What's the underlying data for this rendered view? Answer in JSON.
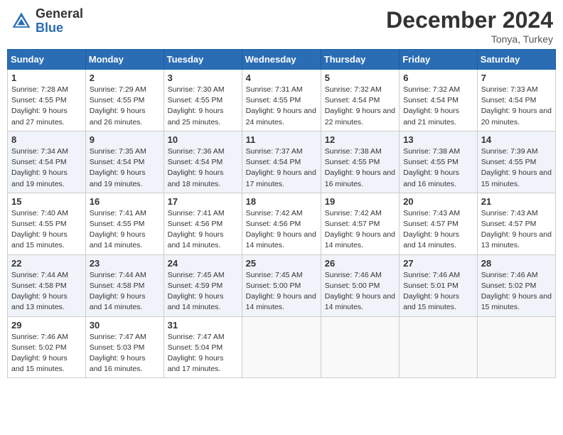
{
  "header": {
    "logo_general": "General",
    "logo_blue": "Blue",
    "title": "December 2024",
    "location": "Tonya, Turkey"
  },
  "days_of_week": [
    "Sunday",
    "Monday",
    "Tuesday",
    "Wednesday",
    "Thursday",
    "Friday",
    "Saturday"
  ],
  "weeks": [
    [
      {
        "day": "1",
        "sunrise": "Sunrise: 7:28 AM",
        "sunset": "Sunset: 4:55 PM",
        "daylight": "Daylight: 9 hours and 27 minutes."
      },
      {
        "day": "2",
        "sunrise": "Sunrise: 7:29 AM",
        "sunset": "Sunset: 4:55 PM",
        "daylight": "Daylight: 9 hours and 26 minutes."
      },
      {
        "day": "3",
        "sunrise": "Sunrise: 7:30 AM",
        "sunset": "Sunset: 4:55 PM",
        "daylight": "Daylight: 9 hours and 25 minutes."
      },
      {
        "day": "4",
        "sunrise": "Sunrise: 7:31 AM",
        "sunset": "Sunset: 4:55 PM",
        "daylight": "Daylight: 9 hours and 24 minutes."
      },
      {
        "day": "5",
        "sunrise": "Sunrise: 7:32 AM",
        "sunset": "Sunset: 4:54 PM",
        "daylight": "Daylight: 9 hours and 22 minutes."
      },
      {
        "day": "6",
        "sunrise": "Sunrise: 7:32 AM",
        "sunset": "Sunset: 4:54 PM",
        "daylight": "Daylight: 9 hours and 21 minutes."
      },
      {
        "day": "7",
        "sunrise": "Sunrise: 7:33 AM",
        "sunset": "Sunset: 4:54 PM",
        "daylight": "Daylight: 9 hours and 20 minutes."
      }
    ],
    [
      {
        "day": "8",
        "sunrise": "Sunrise: 7:34 AM",
        "sunset": "Sunset: 4:54 PM",
        "daylight": "Daylight: 9 hours and 19 minutes."
      },
      {
        "day": "9",
        "sunrise": "Sunrise: 7:35 AM",
        "sunset": "Sunset: 4:54 PM",
        "daylight": "Daylight: 9 hours and 19 minutes."
      },
      {
        "day": "10",
        "sunrise": "Sunrise: 7:36 AM",
        "sunset": "Sunset: 4:54 PM",
        "daylight": "Daylight: 9 hours and 18 minutes."
      },
      {
        "day": "11",
        "sunrise": "Sunrise: 7:37 AM",
        "sunset": "Sunset: 4:54 PM",
        "daylight": "Daylight: 9 hours and 17 minutes."
      },
      {
        "day": "12",
        "sunrise": "Sunrise: 7:38 AM",
        "sunset": "Sunset: 4:55 PM",
        "daylight": "Daylight: 9 hours and 16 minutes."
      },
      {
        "day": "13",
        "sunrise": "Sunrise: 7:38 AM",
        "sunset": "Sunset: 4:55 PM",
        "daylight": "Daylight: 9 hours and 16 minutes."
      },
      {
        "day": "14",
        "sunrise": "Sunrise: 7:39 AM",
        "sunset": "Sunset: 4:55 PM",
        "daylight": "Daylight: 9 hours and 15 minutes."
      }
    ],
    [
      {
        "day": "15",
        "sunrise": "Sunrise: 7:40 AM",
        "sunset": "Sunset: 4:55 PM",
        "daylight": "Daylight: 9 hours and 15 minutes."
      },
      {
        "day": "16",
        "sunrise": "Sunrise: 7:41 AM",
        "sunset": "Sunset: 4:55 PM",
        "daylight": "Daylight: 9 hours and 14 minutes."
      },
      {
        "day": "17",
        "sunrise": "Sunrise: 7:41 AM",
        "sunset": "Sunset: 4:56 PM",
        "daylight": "Daylight: 9 hours and 14 minutes."
      },
      {
        "day": "18",
        "sunrise": "Sunrise: 7:42 AM",
        "sunset": "Sunset: 4:56 PM",
        "daylight": "Daylight: 9 hours and 14 minutes."
      },
      {
        "day": "19",
        "sunrise": "Sunrise: 7:42 AM",
        "sunset": "Sunset: 4:57 PM",
        "daylight": "Daylight: 9 hours and 14 minutes."
      },
      {
        "day": "20",
        "sunrise": "Sunrise: 7:43 AM",
        "sunset": "Sunset: 4:57 PM",
        "daylight": "Daylight: 9 hours and 14 minutes."
      },
      {
        "day": "21",
        "sunrise": "Sunrise: 7:43 AM",
        "sunset": "Sunset: 4:57 PM",
        "daylight": "Daylight: 9 hours and 13 minutes."
      }
    ],
    [
      {
        "day": "22",
        "sunrise": "Sunrise: 7:44 AM",
        "sunset": "Sunset: 4:58 PM",
        "daylight": "Daylight: 9 hours and 13 minutes."
      },
      {
        "day": "23",
        "sunrise": "Sunrise: 7:44 AM",
        "sunset": "Sunset: 4:58 PM",
        "daylight": "Daylight: 9 hours and 14 minutes."
      },
      {
        "day": "24",
        "sunrise": "Sunrise: 7:45 AM",
        "sunset": "Sunset: 4:59 PM",
        "daylight": "Daylight: 9 hours and 14 minutes."
      },
      {
        "day": "25",
        "sunrise": "Sunrise: 7:45 AM",
        "sunset": "Sunset: 5:00 PM",
        "daylight": "Daylight: 9 hours and 14 minutes."
      },
      {
        "day": "26",
        "sunrise": "Sunrise: 7:46 AM",
        "sunset": "Sunset: 5:00 PM",
        "daylight": "Daylight: 9 hours and 14 minutes."
      },
      {
        "day": "27",
        "sunrise": "Sunrise: 7:46 AM",
        "sunset": "Sunset: 5:01 PM",
        "daylight": "Daylight: 9 hours and 15 minutes."
      },
      {
        "day": "28",
        "sunrise": "Sunrise: 7:46 AM",
        "sunset": "Sunset: 5:02 PM",
        "daylight": "Daylight: 9 hours and 15 minutes."
      }
    ],
    [
      {
        "day": "29",
        "sunrise": "Sunrise: 7:46 AM",
        "sunset": "Sunset: 5:02 PM",
        "daylight": "Daylight: 9 hours and 15 minutes."
      },
      {
        "day": "30",
        "sunrise": "Sunrise: 7:47 AM",
        "sunset": "Sunset: 5:03 PM",
        "daylight": "Daylight: 9 hours and 16 minutes."
      },
      {
        "day": "31",
        "sunrise": "Sunrise: 7:47 AM",
        "sunset": "Sunset: 5:04 PM",
        "daylight": "Daylight: 9 hours and 17 minutes."
      },
      null,
      null,
      null,
      null
    ]
  ]
}
